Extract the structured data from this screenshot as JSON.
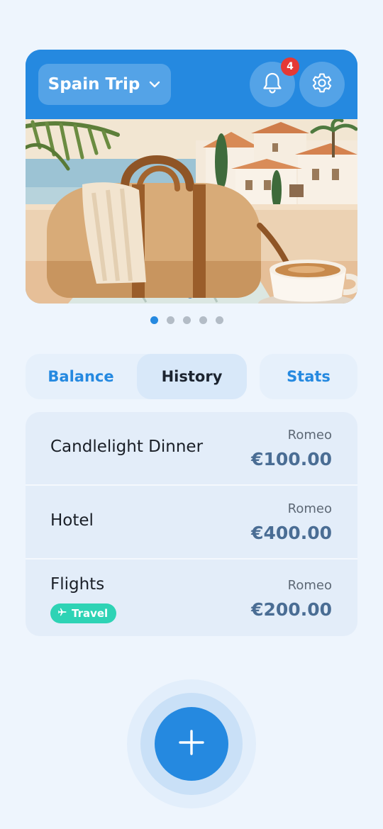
{
  "header": {
    "trip_name": "Spain Trip",
    "notification_count": "4",
    "accent_color": "#2589e0",
    "badge_color": "#e53935",
    "icons": {
      "trip_dropdown": "chevron-down-icon",
      "notifications": "bell-icon",
      "settings": "gear-icon"
    }
  },
  "carousel": {
    "page_count": 5,
    "active_index": 0,
    "image": "travel-illustration: duffel bag, towel, map, coffee cup, Spanish coastal village"
  },
  "tabs": [
    {
      "label": "Balance",
      "active": false
    },
    {
      "label": "History",
      "active": true
    },
    {
      "label": "Stats",
      "active": false
    }
  ],
  "expenses": [
    {
      "title": "Candlelight Dinner",
      "payer": "Romeo",
      "amount": "€100.00",
      "tag": null
    },
    {
      "title": "Hotel",
      "payer": "Romeo",
      "amount": "€400.00",
      "tag": null
    },
    {
      "title": "Flights",
      "payer": "Romeo",
      "amount": "€200.00",
      "tag": {
        "label": "Travel",
        "icon": "airplane-icon",
        "color": "#2ed3b5"
      }
    }
  ],
  "fab": {
    "icon": "plus-icon"
  }
}
